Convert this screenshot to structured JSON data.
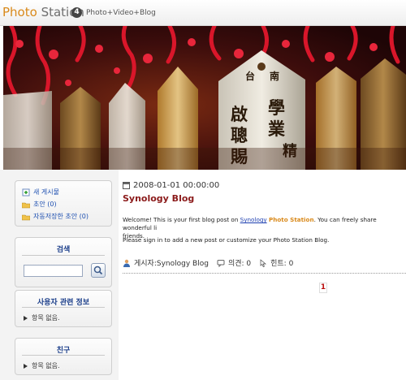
{
  "header": {
    "logo_photo": "Photo",
    "logo_station": "Station",
    "version": "4",
    "tagline": "Photo+Video+Blog"
  },
  "sidebar": {
    "menu": [
      {
        "label": "새 게시물",
        "icon": "new-post-icon"
      },
      {
        "label": "초안 (0)",
        "icon": "folder-icon"
      },
      {
        "label": "자동저장한 초안 (0)",
        "icon": "folder-icon"
      }
    ],
    "search_title": "검색",
    "search_placeholder": "",
    "user_title": "사용자 관련 정보",
    "user_empty": "항목 없음.",
    "friend_title": "친구",
    "friend_empty": "항목 없음."
  },
  "post": {
    "date": "2008-01-01 00:00:00",
    "title": "Synology Blog",
    "body_prefix": "Welcome! This is your first blog post on ",
    "body_link": "Synology",
    "body_ps": "Photo Station",
    "body_suffix": ". You can freely share wonderful li",
    "body_wrap": "friends.",
    "body_line2": "Please sign in to add a new post or customize your Photo Station Blog.",
    "author": "게시자:Synology Blog",
    "comments": "의견: 0",
    "hits": "힌트: 0"
  },
  "pager": {
    "current": "1"
  },
  "colors": {
    "accent": "#d9891a",
    "title": "#8b1a1a",
    "link": "#1d3fb0",
    "box_title": "#1b3e8a"
  }
}
